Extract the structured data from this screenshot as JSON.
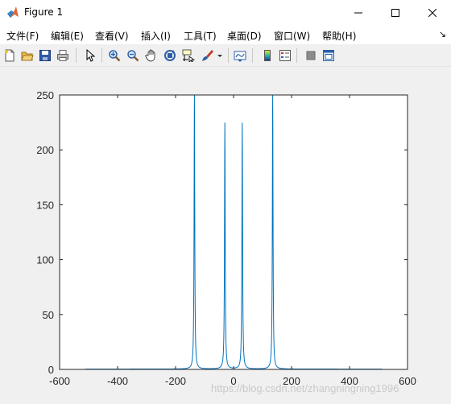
{
  "window": {
    "title": "Figure 1",
    "icon": "matlab-logo-icon"
  },
  "menu": {
    "items": [
      {
        "label": "文件(F)",
        "key": "file"
      },
      {
        "label": "编辑(E)",
        "key": "edit"
      },
      {
        "label": "查看(V)",
        "key": "view"
      },
      {
        "label": "插入(I)",
        "key": "insert"
      },
      {
        "label": "工具(T)",
        "key": "tools"
      },
      {
        "label": "桌面(D)",
        "key": "desktop"
      },
      {
        "label": "窗口(W)",
        "key": "window"
      },
      {
        "label": "帮助(H)",
        "key": "help"
      }
    ],
    "overflow_arrow": "↘"
  },
  "toolbar": {
    "icons": [
      "new-figure-icon",
      "open-file-icon",
      "save-icon",
      "print-icon",
      "edit-plot-icon",
      "zoom-in-icon",
      "zoom-out-icon",
      "pan-icon",
      "rotate-3d-icon",
      "data-cursor-icon",
      "brush-icon",
      "link-plot-icon",
      "colorbar-icon",
      "legend-icon",
      "hide-plot-tools-icon",
      "show-plot-tools-icon"
    ]
  },
  "chart_data": {
    "type": "line",
    "title": "",
    "xlabel": "",
    "ylabel": "",
    "xlim": [
      -600,
      600
    ],
    "ylim": [
      0,
      250
    ],
    "xticks": [
      -600,
      -400,
      -200,
      0,
      200,
      400,
      600
    ],
    "yticks": [
      0,
      50,
      100,
      150,
      200,
      250
    ],
    "x_tick_labels": [
      "-600",
      "-400",
      "-200",
      "0",
      "200",
      "400",
      "600"
    ],
    "y_tick_labels": [
      "0",
      "50",
      "100",
      "150",
      "200",
      "250"
    ],
    "grid": false,
    "line_color": "#0072bd",
    "x_data_range": [
      -512,
      512
    ],
    "peaks": [
      {
        "x": -135,
        "y": 250
      },
      {
        "x": -30,
        "y": 224
      },
      {
        "x": 30,
        "y": 224
      },
      {
        "x": 135,
        "y": 250
      }
    ],
    "baseline": 0.3
  },
  "watermark": "https://blog.csdn.net/zhangningning1996"
}
